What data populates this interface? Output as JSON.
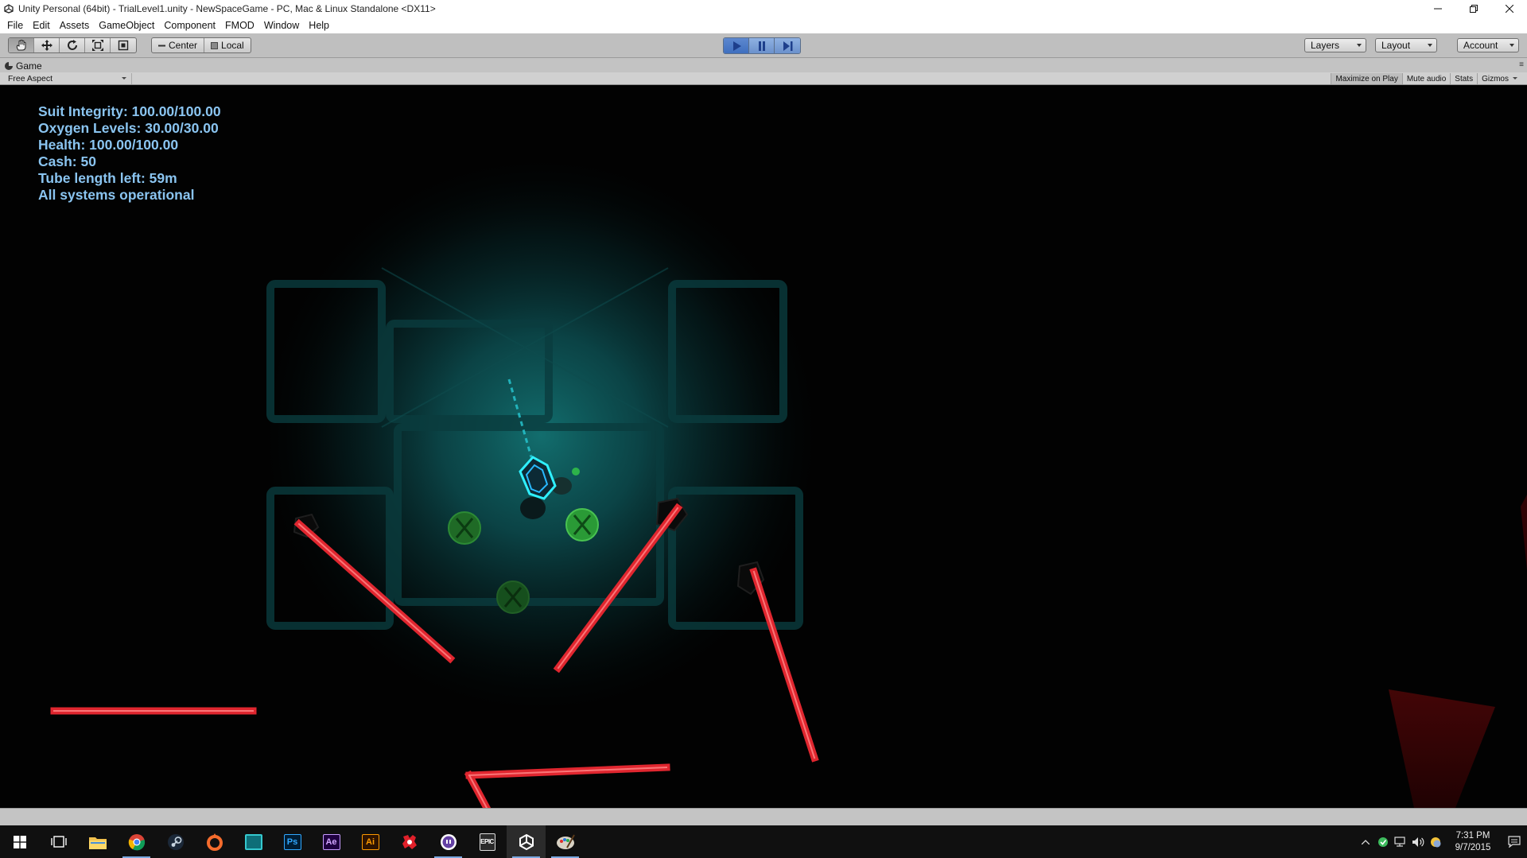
{
  "window": {
    "title": "Unity Personal (64bit) - TrialLevel1.unity - NewSpaceGame - PC, Mac & Linux Standalone <DX11>",
    "controls": [
      "minimize",
      "restore",
      "close"
    ]
  },
  "menu": {
    "items": [
      "File",
      "Edit",
      "Assets",
      "GameObject",
      "Component",
      "FMOD",
      "Window",
      "Help"
    ]
  },
  "toolbar": {
    "transform_tools": [
      "hand-icon",
      "move-icon",
      "rotate-icon",
      "scale-icon",
      "rect-icon"
    ],
    "pivot_label": "Center",
    "space_label": "Local",
    "play_state": "playing",
    "layers_label": "Layers",
    "layout_label": "Layout",
    "account_label": "Account"
  },
  "game_view": {
    "tab_label": "Game",
    "aspect_label": "Free Aspect",
    "options": [
      "Maximize on Play",
      "Mute audio",
      "Stats",
      "Gizmos"
    ],
    "active_options": [
      "Maximize on Play"
    ]
  },
  "hud": {
    "suit_integrity": "Suit Integrity: 100.00/100.00",
    "oxygen": "Oxygen Levels: 30.00/30.00",
    "health": "Health: 100.00/100.00",
    "cash": "Cash: 50",
    "tube_length": "Tube length left: 59m",
    "status": "All systems operational"
  },
  "colors": {
    "hud_text": "#8ac4f0",
    "laser": "#e0262f",
    "ambient_light": "#0f5a5c",
    "play_accent": "#3f6fbf"
  },
  "taskbar": {
    "apps": [
      "windows-icon",
      "task-view-icon",
      "file-explorer-icon",
      "chrome-icon",
      "steam-icon",
      "origin-icon",
      "app-icon",
      "photoshop-icon",
      "after-effects-icon",
      "illustrator-icon",
      "red-app-icon",
      "twitch-icon",
      "epic-games-icon",
      "unity-icon",
      "paint-icon"
    ],
    "ps_label": "Ps",
    "ae_label": "Ae",
    "ai_label": "Ai",
    "epic_label": "EPIC",
    "time": "7:31 PM",
    "date": "9/7/2015"
  }
}
